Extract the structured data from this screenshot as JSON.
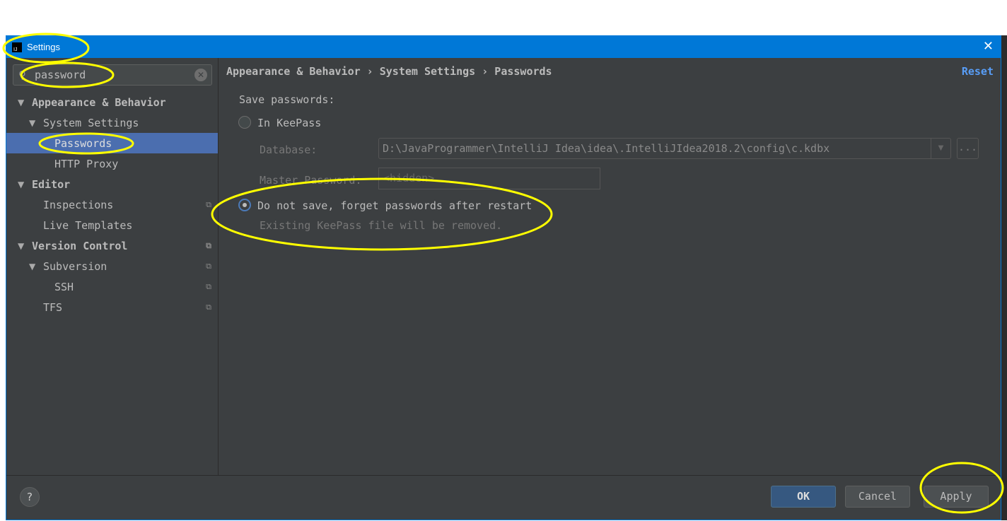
{
  "window": {
    "title": "Settings",
    "close_icon": "close-icon"
  },
  "search": {
    "value": "password"
  },
  "tree": [
    {
      "label": "Appearance & Behavior",
      "level": 0,
      "bold": true,
      "expanded": true
    },
    {
      "label": "System Settings",
      "level": 1,
      "expanded": true
    },
    {
      "label": "Passwords",
      "level": 2,
      "selected": true
    },
    {
      "label": "HTTP Proxy",
      "level": 2
    },
    {
      "label": "Editor",
      "level": 0,
      "bold": true,
      "expanded": true
    },
    {
      "label": "Inspections",
      "level": 1,
      "copy": true
    },
    {
      "label": "Live Templates",
      "level": 1
    },
    {
      "label": "Version Control",
      "level": 0,
      "bold": true,
      "expanded": true,
      "copy": true
    },
    {
      "label": "Subversion",
      "level": 1,
      "expanded": true,
      "copy": true
    },
    {
      "label": "SSH",
      "level": 2,
      "copy": true
    },
    {
      "label": "TFS",
      "level": 1,
      "copy": true
    }
  ],
  "main": {
    "breadcrumb": "Appearance & Behavior › System Settings › Passwords",
    "reset": "Reset",
    "save_label": "Save passwords:",
    "opt_keepass": "In KeePass",
    "database_label": "Database:",
    "database_value": "D:\\JavaProgrammer\\IntelliJ Idea\\idea\\.IntelliJIdea2018.2\\config\\c.kdbx",
    "browse": "...",
    "master_label": "Master Password:",
    "master_placeholder": "<hidden>",
    "opt_nosave": "Do not save, forget passwords after restart",
    "nosave_note": "Existing KeePass file will be removed.",
    "selected_option": "Do not save, forget passwords after restart"
  },
  "footer": {
    "help": "?",
    "ok": "OK",
    "cancel": "Cancel",
    "apply": "Apply"
  },
  "colors": {
    "accent": "#0078d7",
    "selection": "#4b6eaf",
    "link": "#589df6",
    "annotation": "#ffff00"
  }
}
